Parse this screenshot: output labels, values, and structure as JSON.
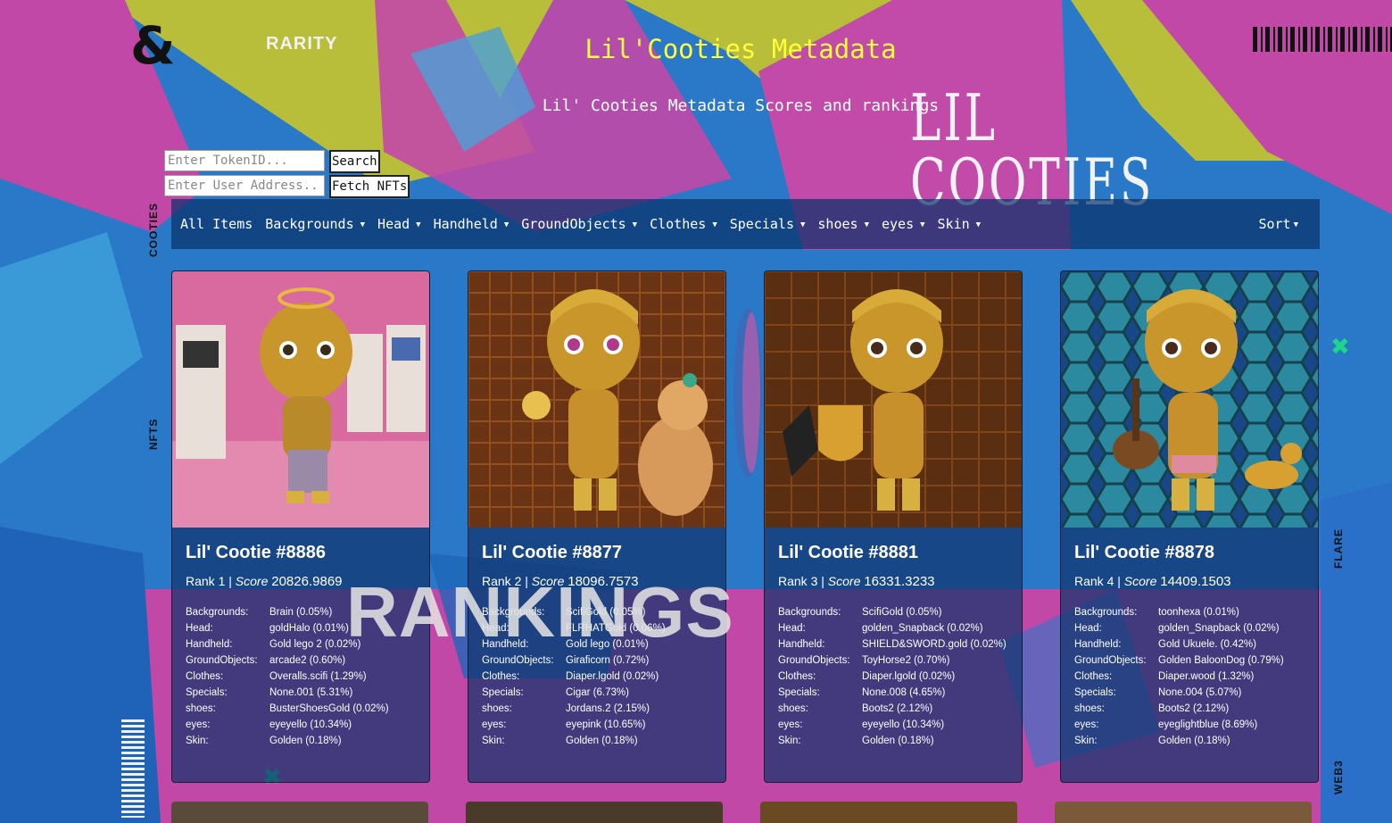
{
  "header": {
    "rarity": "RARITY",
    "title": "Lil'Cooties Metadata",
    "subtitle": "Lil' Cooties Metadata Scores and rankings",
    "brand_art": "LIL COOTIES"
  },
  "search": {
    "token_placeholder": "Enter TokenID...",
    "search_label": "Search",
    "address_placeholder": "Enter User Address...",
    "fetch_label": "Fetch NFTs"
  },
  "nav": {
    "items": [
      {
        "label": "All Items"
      },
      {
        "label": "Backgrounds"
      },
      {
        "label": "Head"
      },
      {
        "label": "Handheld"
      },
      {
        "label": "GroundObjects"
      },
      {
        "label": "Clothes"
      },
      {
        "label": "Specials"
      },
      {
        "label": "shoes"
      },
      {
        "label": "eyes"
      },
      {
        "label": "Skin"
      }
    ],
    "sort": "Sort"
  },
  "side_labels": {
    "cooties": "COOTIES",
    "nfts": "NFTS",
    "flare": "FLARE",
    "web3": "WEB3",
    "x_mark": "✖"
  },
  "rankings_art": "RANKINGS",
  "cards": [
    {
      "name": "Lil' Cootie #8886",
      "rank": "Rank 1 | ",
      "score_label": "Score",
      "score": "20826.9869",
      "bg_color": "#d86aa0",
      "traits": [
        {
          "k": "Backgrounds:",
          "v": "Brain (0.05%)"
        },
        {
          "k": "Head:",
          "v": "goldHalo (0.01%)"
        },
        {
          "k": "Handheld:",
          "v": "Gold lego 2 (0.02%)"
        },
        {
          "k": "GroundObjects:",
          "v": "arcade2 (0.60%)"
        },
        {
          "k": "Clothes:",
          "v": "Overalls.scifi (1.29%)"
        },
        {
          "k": "Specials:",
          "v": "None.001 (5.31%)"
        },
        {
          "k": "shoes:",
          "v": "BusterShoesGold (0.02%)"
        },
        {
          "k": "eyes:",
          "v": "eyeyello (10.34%)"
        },
        {
          "k": "Skin:",
          "v": "Golden (0.18%)"
        }
      ]
    },
    {
      "name": "Lil' Cootie #8877",
      "rank": "Rank 2 | ",
      "score_label": "Score",
      "score": "18096.7573",
      "bg_color": "#6a3414",
      "traits": [
        {
          "k": "Backgrounds:",
          "v": "ScifiGold (0.05%)"
        },
        {
          "k": "Head:",
          "v": "FLRHATGold (0.06%)"
        },
        {
          "k": "Handheld:",
          "v": "Gold lego (0.01%)"
        },
        {
          "k": "GroundObjects:",
          "v": "Giraficorn (0.72%)"
        },
        {
          "k": "Clothes:",
          "v": "Diaper.lgold (0.02%)"
        },
        {
          "k": "Specials:",
          "v": "Cigar (6.73%)"
        },
        {
          "k": "shoes:",
          "v": "Jordans.2 (2.15%)"
        },
        {
          "k": "eyes:",
          "v": "eyepink (10.65%)"
        },
        {
          "k": "Skin:",
          "v": "Golden (0.18%)"
        }
      ]
    },
    {
      "name": "Lil' Cootie #8881",
      "rank": "Rank 3 | ",
      "score_label": "Score",
      "score": "16331.3233",
      "bg_color": "#5a2e10",
      "traits": [
        {
          "k": "Backgrounds:",
          "v": "ScifiGold (0.05%)"
        },
        {
          "k": "Head:",
          "v": "golden_Snapback (0.02%)"
        },
        {
          "k": "Handheld:",
          "v": "SHIELD&SWORD.gold (0.02%)"
        },
        {
          "k": "GroundObjects:",
          "v": "ToyHorse2 (0.70%)"
        },
        {
          "k": "Clothes:",
          "v": "Diaper.lgold (0.02%)"
        },
        {
          "k": "Specials:",
          "v": "None.008 (4.65%)"
        },
        {
          "k": "shoes:",
          "v": "Boots2 (2.12%)"
        },
        {
          "k": "eyes:",
          "v": "eyeyello (10.34%)"
        },
        {
          "k": "Skin:",
          "v": "Golden (0.18%)"
        }
      ]
    },
    {
      "name": "Lil' Cootie #8878",
      "rank": "Rank 4 | ",
      "score_label": "Score",
      "score": "14409.1503",
      "bg_color": "#2b7f96",
      "traits": [
        {
          "k": "Backgrounds:",
          "v": "toonhexa (0.01%)"
        },
        {
          "k": "Head:",
          "v": "golden_Snapback (0.02%)"
        },
        {
          "k": "Handheld:",
          "v": "Gold Ukuele. (0.42%)"
        },
        {
          "k": "GroundObjects:",
          "v": "Golden BaloonDog (0.79%)"
        },
        {
          "k": "Clothes:",
          "v": "Diaper.wood (1.32%)"
        },
        {
          "k": "Specials:",
          "v": "None.004 (5.07%)"
        },
        {
          "k": "shoes:",
          "v": "Boots2 (2.12%)"
        },
        {
          "k": "eyes:",
          "v": "eyeglightblue (8.69%)"
        },
        {
          "k": "Skin:",
          "v": "Golden (0.18%)"
        }
      ]
    }
  ]
}
